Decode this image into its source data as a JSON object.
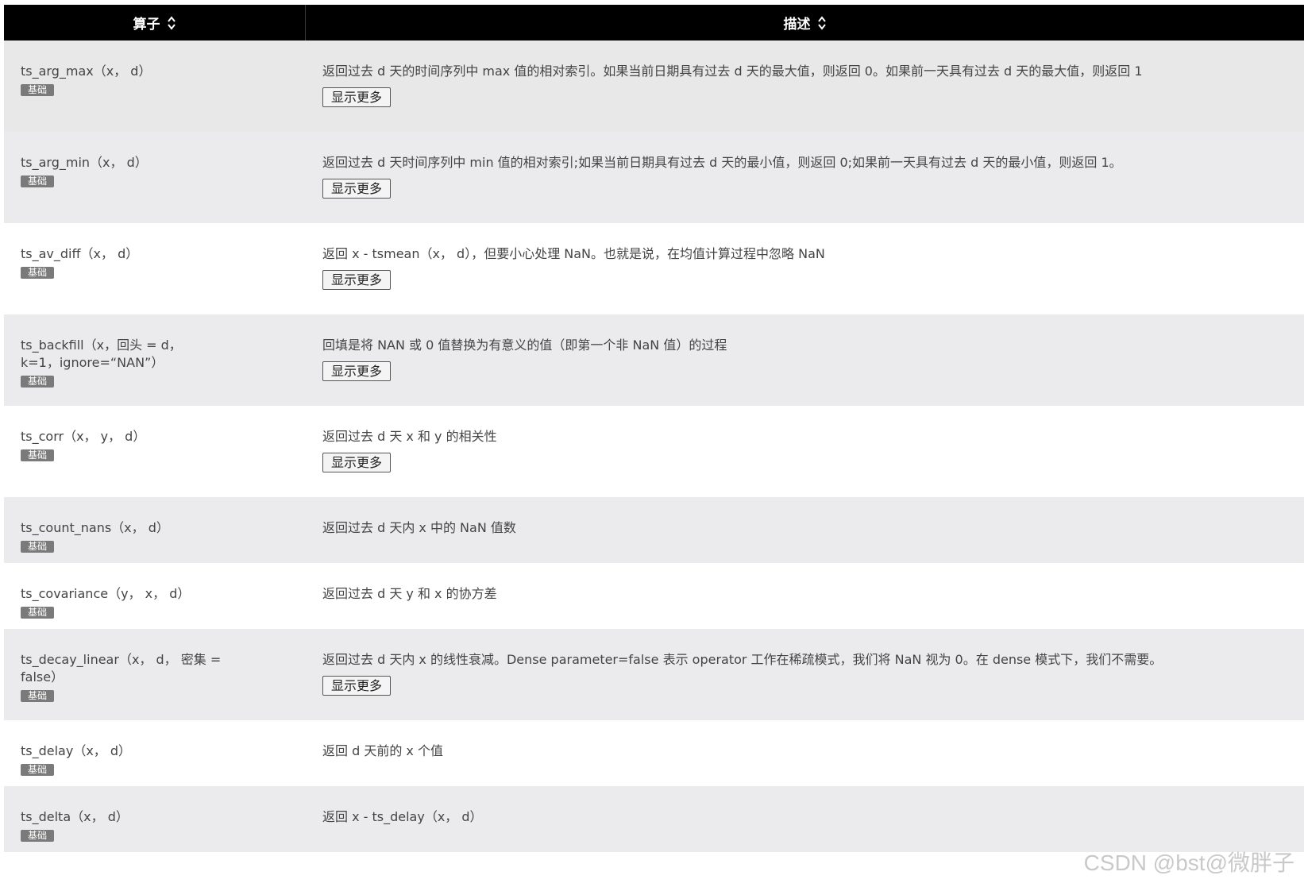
{
  "header": {
    "col_operator": "算子",
    "col_description": "描述"
  },
  "rows": [
    {
      "name": "ts_arg_max（x， d）",
      "badge": "基础",
      "desc": "返回过去 d 天的时间序列中 max 值的相对索引。如果当前日期具有过去 d 天的最大值，则返回 0。如果前一天具有过去 d 天的最大值，则返回 1",
      "more": "显示更多"
    },
    {
      "name": "ts_arg_min（x， d）",
      "badge": "基础",
      "desc": "返回过去 d 天时间序列中 min 值的相对索引;如果当前日期具有过去 d 天的最小值，则返回 0;如果前一天具有过去 d 天的最小值，则返回 1。",
      "more": "显示更多"
    },
    {
      "name": "ts_av_diff（x， d）",
      "badge": "基础",
      "desc": "返回 x - tsmean（x， d），但要小心处理 NaN。也就是说，在均值计算过程中忽略 NaN",
      "more": "显示更多"
    },
    {
      "name": "ts_backfill（x，回头 = d， k=1，ignore=“NAN”）",
      "badge": "基础",
      "desc": "回填是将 NAN 或 0 值替换为有意义的值（即第一个非 NaN 值）的过程",
      "more": "显示更多"
    },
    {
      "name": "ts_corr（x， y， d）",
      "badge": "基础",
      "desc": "返回过去 d 天 x 和 y 的相关性",
      "more": "显示更多"
    },
    {
      "name": "ts_count_nans（x， d）",
      "badge": "基础",
      "desc": "返回过去 d 天内 x 中的 NaN 值数"
    },
    {
      "name": "ts_covariance（y， x， d）",
      "badge": "基础",
      "desc": "返回过去 d 天 y 和 x 的协方差"
    },
    {
      "name": "ts_decay_linear（x， d， 密集 = false）",
      "badge": "基础",
      "desc": "返回过去 d 天内 x 的线性衰减。Dense parameter=false 表示 operator 工作在稀疏模式，我们将 NaN 视为 0。在 dense 模式下，我们不需要。",
      "more": "显示更多"
    },
    {
      "name": "ts_delay（x， d）",
      "badge": "基础",
      "desc": "返回 d 天前的 x 个值"
    },
    {
      "name": "ts_delta（x， d）",
      "badge": "基础",
      "desc": "返回 x - ts_delay（x， d）"
    }
  ],
  "watermark": "CSDN @bst@微胖子",
  "icons": {
    "sort": "sort-updown-icon"
  },
  "colors": {
    "header_bg": "#000000",
    "row_shade": "#ebebee",
    "badge_bg": "#7a7a7a"
  }
}
